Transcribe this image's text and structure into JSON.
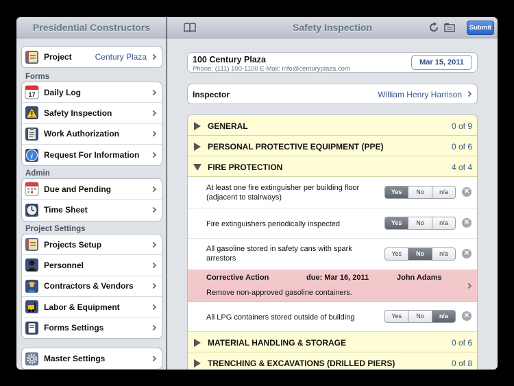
{
  "sidebar": {
    "title": "Presidential Constructors",
    "project": {
      "label": "Project",
      "value": "Century Plaza"
    },
    "forms_header": "Forms",
    "forms": [
      {
        "label": "Daily Log",
        "icon": "calendar-icon"
      },
      {
        "label": "Safety Inspection",
        "icon": "warning-icon"
      },
      {
        "label": "Work Authorization",
        "icon": "clipboard-icon"
      },
      {
        "label": "Request For Information",
        "icon": "info-icon"
      }
    ],
    "admin_header": "Admin",
    "admin": [
      {
        "label": "Due and Pending",
        "icon": "calendar-due-icon"
      },
      {
        "label": "Time Sheet",
        "icon": "clock-icon"
      }
    ],
    "settings_header": "Project Settings",
    "settings": [
      {
        "label": "Projects Setup",
        "icon": "notebook-icon"
      },
      {
        "label": "Personnel",
        "icon": "person-icon"
      },
      {
        "label": "Contractors & Vendors",
        "icon": "worker-icon"
      },
      {
        "label": "Labor & Equipment",
        "icon": "forklift-icon"
      },
      {
        "label": "Forms Settings",
        "icon": "form-icon"
      }
    ],
    "master": {
      "label": "Master Settings",
      "icon": "gear-icon"
    }
  },
  "main": {
    "title": "Safety Inspection",
    "submit_label": "Submit",
    "project_name": "100 Century Plaza",
    "project_contact": "Phone: (111) 100-1100  E-Mail: info@centuryplaza.com",
    "date": "Mar 15, 2011",
    "inspector_label": "Inspector",
    "inspector_value": "William Henry Harrison",
    "segment_labels": [
      "Yes",
      "No",
      "n/a"
    ],
    "sections": [
      {
        "title": "GENERAL",
        "count": "0 of 9"
      },
      {
        "title": "PERSONAL PROTECTIVE EQUIPMENT (PPE)",
        "count": "0 of 6"
      },
      {
        "title": "FIRE PROTECTION",
        "count": "4 of 4"
      },
      {
        "title": "MATERIAL HANDLING & STORAGE",
        "count": "0 of 6"
      },
      {
        "title": "TRENCHING & EXCAVATIONS (DRILLED PIERS)",
        "count": "0 of 8"
      }
    ],
    "items": [
      {
        "text": "At least one fire extinguisher per building floor (adjacent to stairways)",
        "answer": "Yes"
      },
      {
        "text": "Fire extinguishers periodically inspected",
        "answer": "Yes"
      },
      {
        "text": "All gasoline stored in safety cans with spark arrestors",
        "answer": "No"
      },
      {
        "text": "All LPG containers stored outside of building",
        "answer": "n/a"
      }
    ],
    "corrective": {
      "label": "Corrective Action",
      "due": "due: Mar 16, 2011",
      "assignee": "John Adams",
      "description": "Remove non-approved gasoline containers."
    }
  },
  "colors": {
    "section_bg": "#fffdd6",
    "corrective_bg": "#f3c8ca",
    "link_blue": "#3b5a8f",
    "submit_blue": "#2a64cc"
  }
}
